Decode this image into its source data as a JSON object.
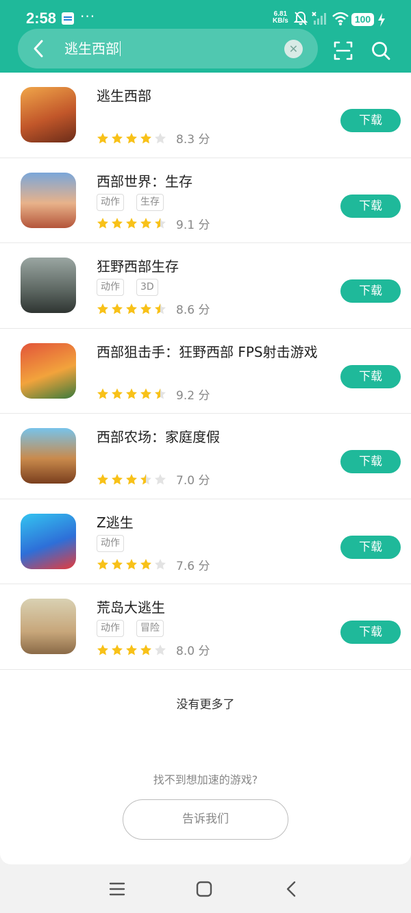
{
  "status_bar": {
    "time": "2:58",
    "dots": "···",
    "net_speed_value": "6.81",
    "net_speed_unit": "KB/s",
    "battery": "100",
    "icons": [
      "notification-mute-icon",
      "signal-off-icon",
      "wifi-icon",
      "charging-icon"
    ]
  },
  "search": {
    "query": "逃生西部",
    "icons": [
      "back-icon",
      "clear-icon",
      "scan-icon",
      "search-icon"
    ]
  },
  "results": [
    {
      "name": "逃生西部",
      "tags": [],
      "rating": 4,
      "score": "8.3 分",
      "button": "下载"
    },
    {
      "name": "西部世界：生存",
      "tags": [
        "动作",
        "生存"
      ],
      "rating": 4.5,
      "score": "9.1 分",
      "button": "下载"
    },
    {
      "name": "狂野西部生存",
      "tags": [
        "动作",
        "3D"
      ],
      "rating": 4.5,
      "score": "8.6 分",
      "button": "下载"
    },
    {
      "name": "西部狙击手：狂野西部 FPS射击游戏",
      "tags": [],
      "rating": 4.5,
      "score": "9.2 分",
      "button": "下载"
    },
    {
      "name": "西部农场：家庭度假",
      "tags": [],
      "rating": 3.5,
      "score": "7.0 分",
      "button": "下载"
    },
    {
      "name": "Z逃生",
      "tags": [
        "动作"
      ],
      "rating": 4,
      "score": "7.6 分",
      "button": "下载"
    },
    {
      "name": "荒岛大逃生",
      "tags": [
        "动作",
        "冒险"
      ],
      "rating": 4,
      "score": "8.0 分",
      "button": "下载"
    }
  ],
  "footer": {
    "no_more": "没有更多了",
    "hint": "找不到想加速的游戏?",
    "tell_us": "告诉我们"
  },
  "nav_bar": {
    "icons": [
      "menu-icon",
      "home-icon",
      "back-icon"
    ]
  },
  "colors": {
    "accent": "#1fb99a",
    "star": "#f8c118",
    "star_empty": "#e3e3e3"
  }
}
